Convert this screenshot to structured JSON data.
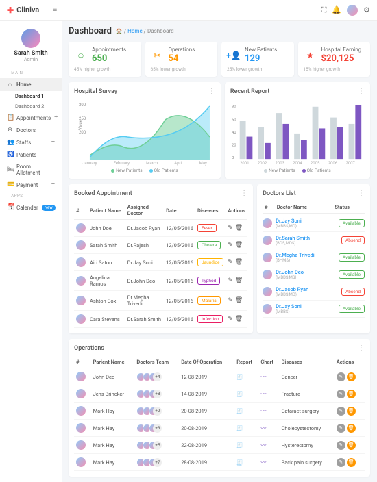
{
  "brand": "Cliniva",
  "user": {
    "name": "Sarah Smith",
    "role": "Admin"
  },
  "menu": {
    "section1": "-- MAIN",
    "home": "Home",
    "dash1": "Dashboard 1",
    "dash2": "Dashboard 2",
    "appointments": "Appointments",
    "doctors": "Doctors",
    "staffs": "Staffs",
    "patients": "Patients",
    "room": "Room Allotment",
    "payment": "Payment",
    "section2": "-- APPS",
    "calendar": "Calendar",
    "new": "New"
  },
  "page": {
    "title": "Dashboard",
    "home": "Home",
    "crumb": "Dashboard"
  },
  "stats": [
    {
      "label": "Appointments",
      "value": "650",
      "growth": "45% higher growth",
      "color": "#4caf50",
      "icon": "☺"
    },
    {
      "label": "Operations",
      "value": "54",
      "growth": "65% lower growth",
      "color": "#ff9800",
      "icon": "✂"
    },
    {
      "label": "New Patients",
      "value": "129",
      "growth": "25% lower growth",
      "color": "#2196f3",
      "icon": "+👤"
    },
    {
      "label": "Hospital Earning",
      "value": "$20,125",
      "growth": "15% higher growth",
      "color": "#f44336",
      "icon": "★"
    }
  ],
  "chart_data": [
    {
      "type": "area",
      "title": "Hospital Survay",
      "categories": [
        "January",
        "February",
        "March",
        "April",
        "May"
      ],
      "ylabel": "Value",
      "ylim": [
        0,
        400
      ],
      "series": [
        {
          "name": "New Patients",
          "color": "#6fcf97",
          "values": [
            40,
            100,
            80,
            280,
            150
          ]
        },
        {
          "name": "Old Patients",
          "color": "#56ccf2",
          "values": [
            20,
            180,
            170,
            190,
            380
          ]
        }
      ]
    },
    {
      "type": "bar",
      "title": "Recent Report",
      "categories": [
        "2001",
        "2002",
        "2003",
        "2004",
        "2005",
        "2006",
        "2007"
      ],
      "ylim": [
        0,
        90
      ],
      "series": [
        {
          "name": "New Patients",
          "color": "#cfd8dc",
          "values": [
            60,
            50,
            72,
            40,
            82,
            65,
            55
          ]
        },
        {
          "name": "Old Patients",
          "color": "#7e57c2",
          "values": [
            35,
            25,
            55,
            30,
            48,
            50,
            85
          ]
        }
      ]
    }
  ],
  "booked": {
    "title": "Booked Appointment",
    "headers": [
      "#",
      "Patient Name",
      "Assigned Doctor",
      "Date",
      "Diseases",
      "Actions"
    ],
    "rows": [
      {
        "patient": "John Doe",
        "doctor": "Dr.Jacob Ryan",
        "date": "12/05/2016",
        "disease": "Fever",
        "dcolor": "#f44336"
      },
      {
        "patient": "Sarah Smith",
        "doctor": "Dr.Rajesh",
        "date": "12/05/2016",
        "disease": "Cholera",
        "dcolor": "#4caf50"
      },
      {
        "patient": "Airi Satou",
        "doctor": "Dr.Jay Soni",
        "date": "12/05/2016",
        "disease": "Jaundice",
        "dcolor": "#ffb300"
      },
      {
        "patient": "Angelica Ramos",
        "doctor": "Dr.John Deo",
        "date": "12/05/2016",
        "disease": "Typhod",
        "dcolor": "#9c27b0"
      },
      {
        "patient": "Ashton Cox",
        "doctor": "Dr.Megha Trivedi",
        "date": "12/05/2016",
        "disease": "Malaria",
        "dcolor": "#ff9800"
      },
      {
        "patient": "Cara Stevens",
        "doctor": "Dr.Sarah Smith",
        "date": "12/05/2016",
        "disease": "Infection",
        "dcolor": "#e91e63"
      }
    ]
  },
  "doctors": {
    "title": "Doctors List",
    "headers": [
      "#",
      "Doctor Name",
      "Status"
    ],
    "rows": [
      {
        "name": "Dr.Jay Soni",
        "spec": "(MBBS,MD)",
        "status": "Available",
        "scolor": "#4caf50"
      },
      {
        "name": "Dr.Sarah Smith",
        "spec": "(BDS,MDS)",
        "status": "Absend",
        "scolor": "#f44336"
      },
      {
        "name": "Dr.Megha Trivedi",
        "spec": "(BHMS)",
        "status": "Available",
        "scolor": "#4caf50"
      },
      {
        "name": "Dr.John Deo",
        "spec": "(MBBS,MS)",
        "status": "Available",
        "scolor": "#4caf50"
      },
      {
        "name": "Dr.Jacob Ryan",
        "spec": "(MBBS,MD)",
        "status": "Absend",
        "scolor": "#f44336"
      },
      {
        "name": "Dr.Jay Soni",
        "spec": "(MBBS)",
        "status": "Available",
        "scolor": "#4caf50"
      }
    ]
  },
  "operations": {
    "title": "Operations",
    "headers": [
      "#",
      "Parient Name",
      "Doctors Team",
      "Date Of Operation",
      "Report",
      "Chart",
      "Diseases",
      "Actions"
    ],
    "rows": [
      {
        "patient": "John Deo",
        "team": "+4",
        "date": "12-08-2019",
        "disease": "Cancer"
      },
      {
        "patient": "Jens Brincker",
        "team": "+8",
        "date": "14-08-2019",
        "disease": "Fracture"
      },
      {
        "patient": "Mark Hay",
        "team": "+2",
        "date": "20-08-2019",
        "disease": "Cataract surgery"
      },
      {
        "patient": "Mark Hay",
        "team": "+3",
        "date": "20-08-2019",
        "disease": "Cholecystectomy"
      },
      {
        "patient": "Mark Hay",
        "team": "+5",
        "date": "22-08-2019",
        "disease": "Hysterectomy"
      },
      {
        "patient": "Mark Hay",
        "team": "+7",
        "date": "28-08-2019",
        "disease": "Back pain surgery"
      }
    ]
  }
}
